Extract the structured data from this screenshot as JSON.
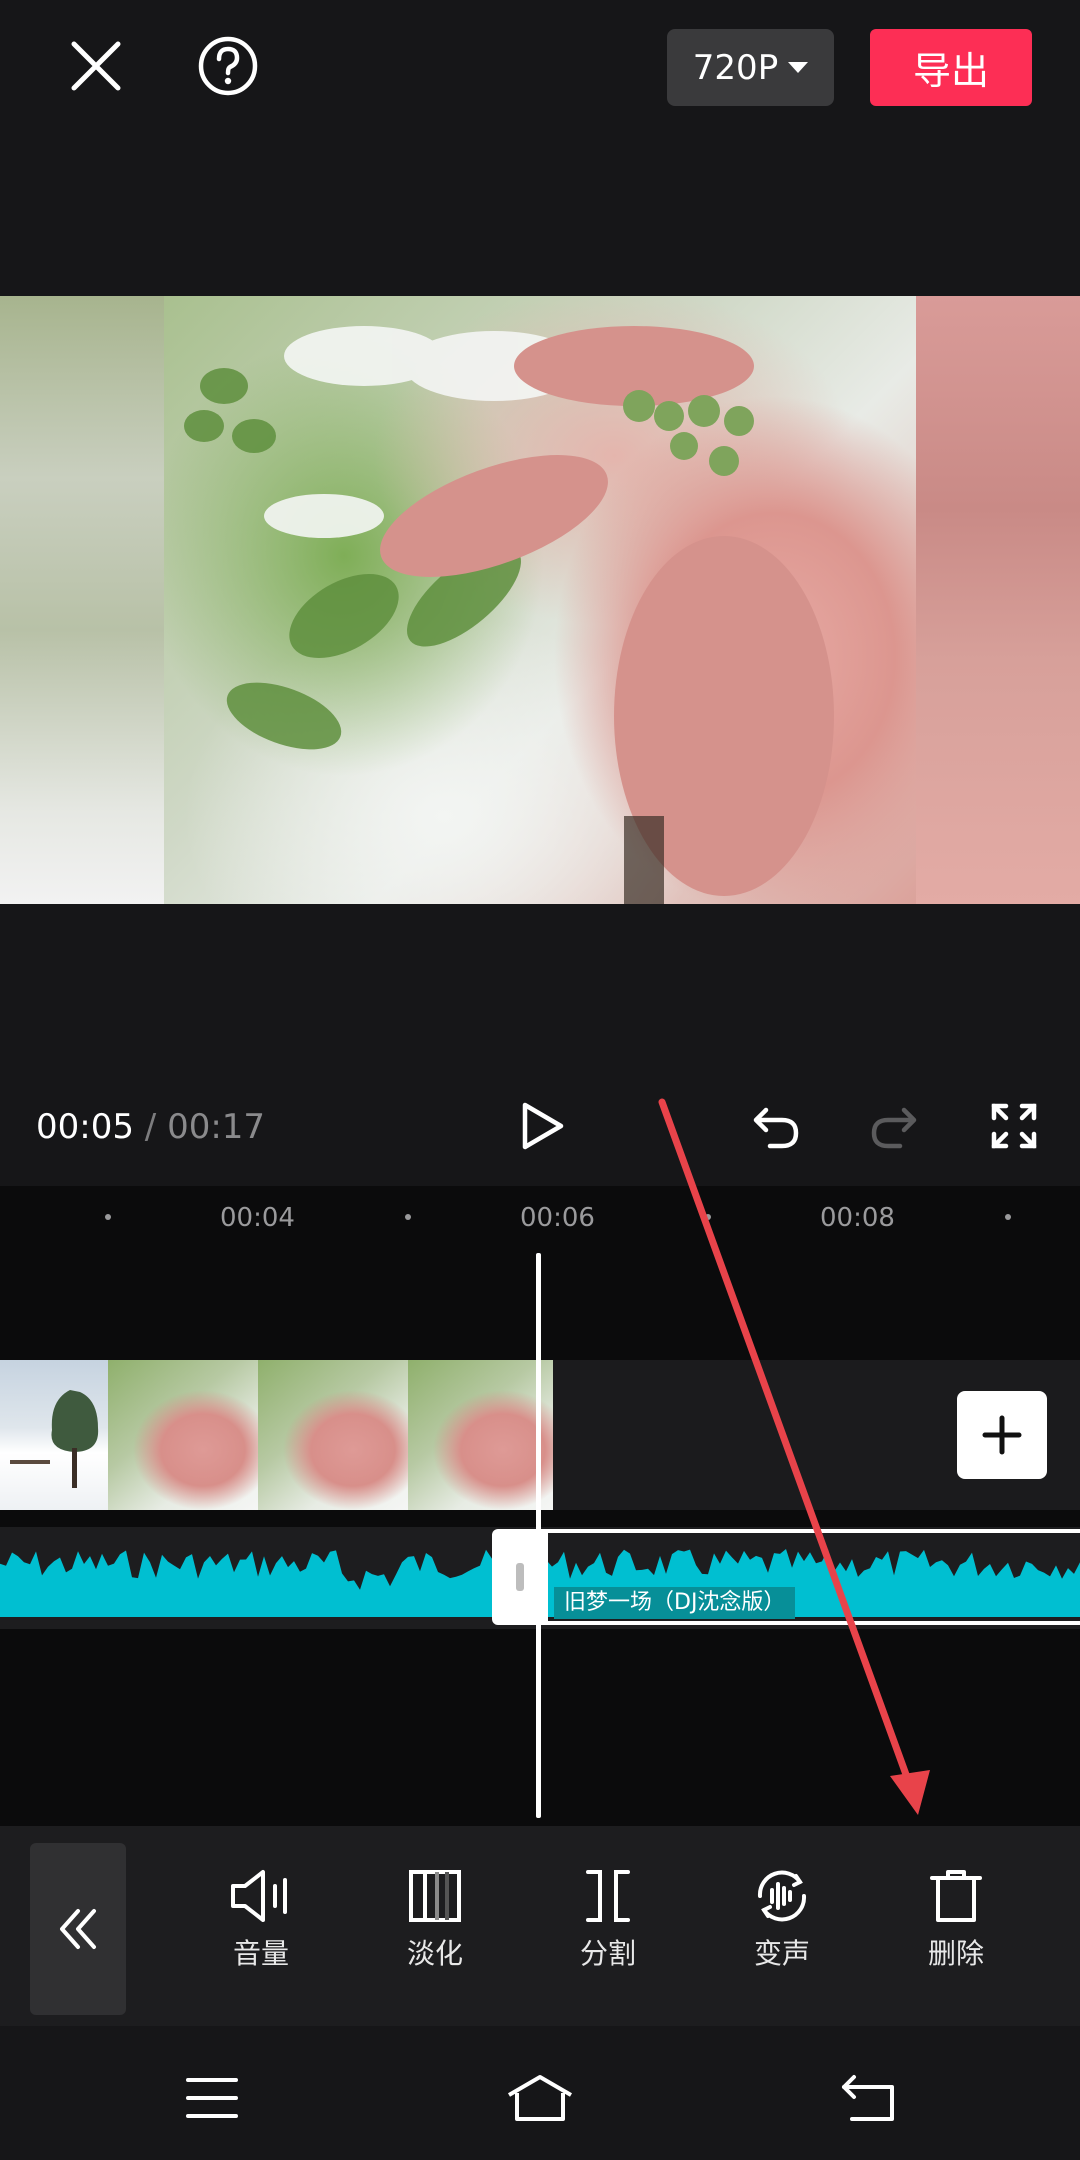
{
  "header": {
    "close_icon": "close-icon",
    "help_icon": "help-icon",
    "resolution": "720P",
    "export_label": "导出"
  },
  "playback": {
    "current_time": "00:05",
    "separator": " / ",
    "total_time": "00:17"
  },
  "ruler": {
    "labels": [
      "00:04",
      "00:06",
      "00:08"
    ]
  },
  "audio": {
    "track_name": "旧梦一场（DJ沈念版）"
  },
  "toolbar": {
    "items": [
      {
        "label": "音量",
        "icon": "volume-icon"
      },
      {
        "label": "淡化",
        "icon": "fade-icon"
      },
      {
        "label": "分割",
        "icon": "split-icon"
      },
      {
        "label": "变声",
        "icon": "voice-change-icon"
      },
      {
        "label": "删除",
        "icon": "delete-icon"
      }
    ]
  },
  "colors": {
    "accent": "#fd2e55",
    "waveform": "#00bfd1",
    "annotation_arrow": "#e8434a"
  }
}
